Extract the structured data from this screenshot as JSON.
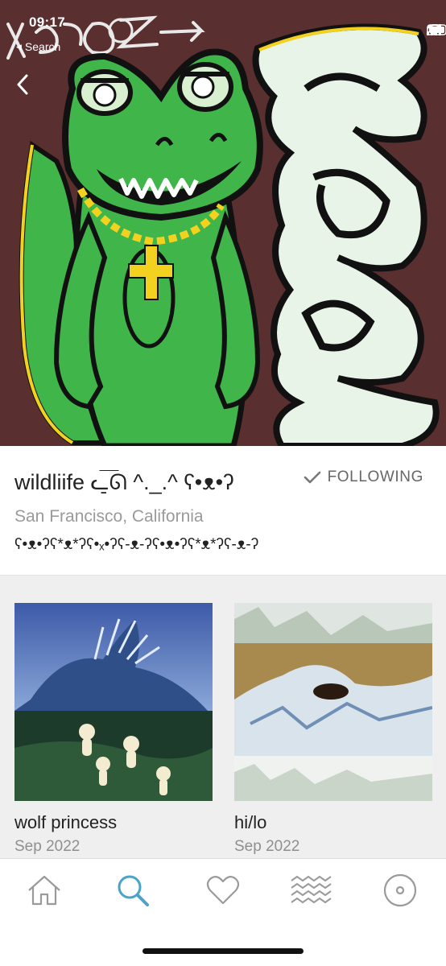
{
  "status_bar": {
    "time": "09:17",
    "back_app": "Search"
  },
  "header": {
    "artwork": "green-crocodile-hilo-artwork",
    "back_icon": "chevron-left-icon"
  },
  "profile": {
    "name": "wildliife ᓚ̠͞ᘏ ^._.^ ʕ•ᴥ•ʔ",
    "follow_label": "FOLLOWING",
    "location": "San Francisco, California",
    "bio": "ʕ•ᴥ•ʔʕ*ᴥ*ʔʕ•ₓ•ʔʕ-ᴥ-ʔʕ•ᴥ•ʔʕ*ᴥ*ʔʕ-ᴥ-ʔ"
  },
  "releases": [
    {
      "title": "wolf princess",
      "date": "Sep 2022"
    },
    {
      "title": "hi/lo",
      "date": "Sep 2022"
    }
  ],
  "tabbar": {
    "items": [
      {
        "icon": "home-icon"
      },
      {
        "icon": "search-icon",
        "active": true
      },
      {
        "icon": "heart-icon"
      },
      {
        "icon": "waves-icon"
      },
      {
        "icon": "record-icon"
      }
    ],
    "active_color": "#4aa3c9",
    "inactive_color": "#9a9a9a"
  },
  "colors": {
    "hero_background": "#5a2f2f",
    "croc_green": "#3fb54a",
    "chain_yellow": "#f3d21f"
  }
}
